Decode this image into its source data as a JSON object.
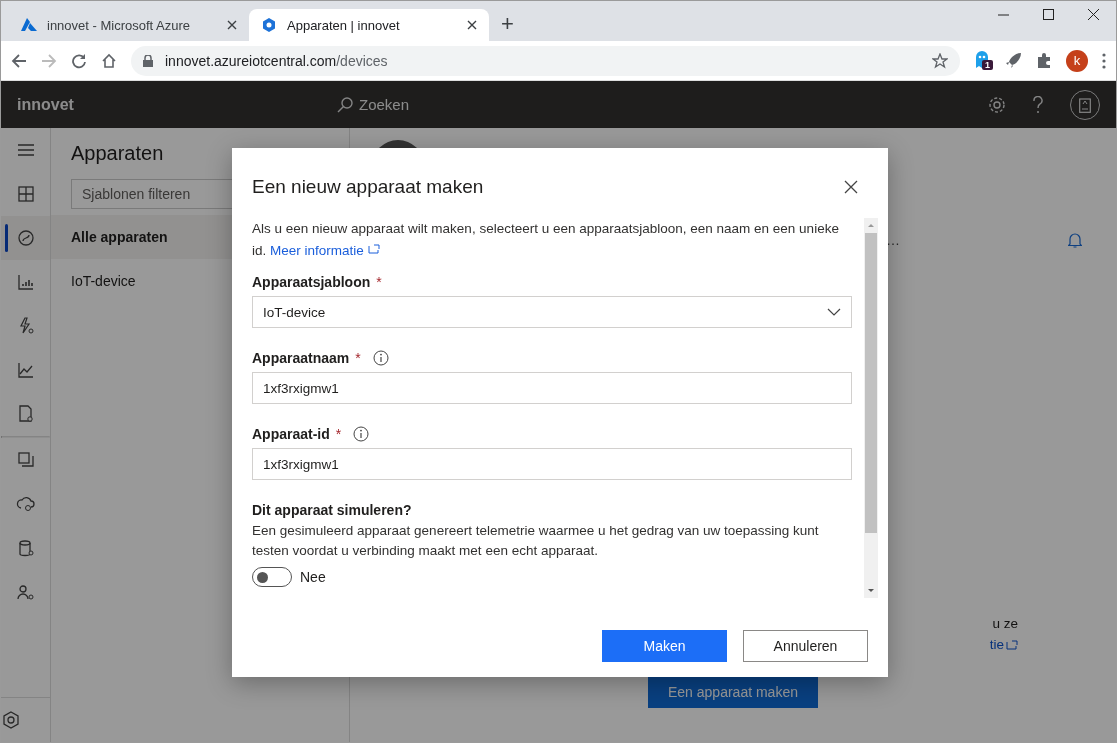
{
  "browser": {
    "tabs": [
      {
        "title": "innovet - Microsoft Azure",
        "selected": false,
        "kind": "azure"
      },
      {
        "title": "Apparaten | innovet",
        "selected": true,
        "kind": "iot"
      }
    ],
    "new_tab": "+",
    "address": {
      "host": "innovet.azureiotcentral.com",
      "path": "/devices"
    },
    "extension_badge": "1",
    "profile": "k"
  },
  "app": {
    "name": "innovet",
    "search_placeholder": "Zoeken"
  },
  "nav_rail": [
    {
      "kind": "menu",
      "selected": false
    },
    {
      "kind": "dashboard",
      "selected": false
    },
    {
      "kind": "devices",
      "selected": true
    },
    {
      "kind": "analytics",
      "selected": false
    },
    {
      "kind": "rules",
      "selected": false
    },
    {
      "kind": "chart",
      "selected": false
    },
    {
      "kind": "jobs",
      "selected": false
    },
    {
      "kind": "templates",
      "selected": false
    },
    {
      "kind": "export",
      "selected": false
    },
    {
      "kind": "data",
      "selected": false
    },
    {
      "kind": "users",
      "selected": false
    },
    {
      "kind": "admin",
      "selected": false
    }
  ],
  "sidebar": {
    "title": "Apparaten",
    "filter_placeholder": "Sjablonen filteren",
    "items": [
      {
        "label": "Alle apparaten",
        "selected": true
      },
      {
        "label": "IoT-device",
        "selected": false
      }
    ]
  },
  "main": {
    "more": "…",
    "text_fragment": "u ze",
    "link_fragment": "tie",
    "button": "Een apparaat maken"
  },
  "dialog": {
    "title": "Een nieuw apparaat maken",
    "intro": "Als u een nieuw apparaat wilt maken, selecteert u een apparaatsjabloon, een naam en een unieke id.",
    "link": "Meer informatie",
    "fields": [
      {
        "label": "Apparaatsjabloon",
        "required_mark": "*",
        "info": false,
        "kind": "select",
        "value": "IoT-device"
      },
      {
        "label": "Apparaatnaam",
        "required_mark": "*",
        "info": true,
        "kind": "text",
        "value": "1xf3rxigmw1"
      },
      {
        "label": "Apparaat-id",
        "required_mark": "*",
        "info": true,
        "kind": "text",
        "value": "1xf3rxigmw1"
      }
    ],
    "simulate": {
      "title": "Dit apparaat simuleren?",
      "description": "Een gesimuleerd apparaat genereert telemetrie waarmee u het gedrag van uw toepassing kunt testen voordat u verbinding maakt met een echt apparaat.",
      "on": false,
      "state_label": "Nee"
    },
    "buttons": [
      {
        "label": "Maken",
        "kind": "primary"
      },
      {
        "label": "Annuleren",
        "kind": "secondary"
      }
    ]
  }
}
